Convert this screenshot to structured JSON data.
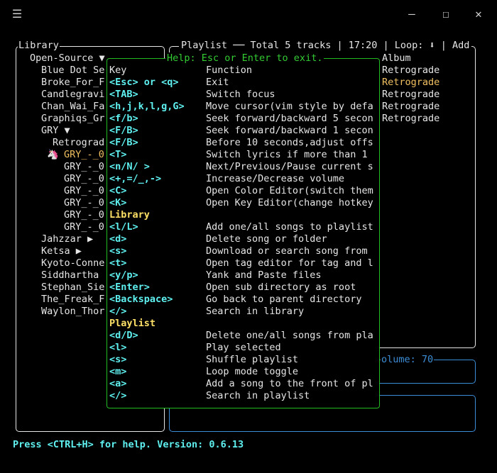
{
  "titlebar": {
    "menu_icon": "☰",
    "minimize": "—",
    "maximize": "☐",
    "close": "✕"
  },
  "library": {
    "title": "Library",
    "items": [
      {
        "text": "Open-Source ▼",
        "indent": 1
      },
      {
        "text": "Blue Dot Se",
        "indent": 2
      },
      {
        "text": "Broke_For_F",
        "indent": 2
      },
      {
        "text": "Candlegravi",
        "indent": 2
      },
      {
        "text": "Chan_Wai_Fa",
        "indent": 2
      },
      {
        "text": "Graphiqs_Gr",
        "indent": 2
      },
      {
        "text": "GRY ▼",
        "indent": 2
      },
      {
        "text": "Retrograd",
        "indent": 3
      },
      {
        "text": "GRY_-_0",
        "indent": 4,
        "selected": true
      },
      {
        "text": "GRY_-_0",
        "indent": 4
      },
      {
        "text": "GRY_-_0",
        "indent": 4
      },
      {
        "text": "GRY_-_0",
        "indent": 4
      },
      {
        "text": "GRY_-_0",
        "indent": 4
      },
      {
        "text": "GRY_-_0",
        "indent": 4
      },
      {
        "text": "GRY_-_0",
        "indent": 4
      },
      {
        "text": "Jahzzar ▶",
        "indent": 2
      },
      {
        "text": "Ketsa ▶",
        "indent": 2
      },
      {
        "text": "Kyoto-Conne",
        "indent": 2
      },
      {
        "text": "Siddhartha",
        "indent": 2
      },
      {
        "text": "Stephan_Sie",
        "indent": 2
      },
      {
        "text": "The_Freak_F",
        "indent": 2
      },
      {
        "text": "Waylon_Thor",
        "indent": 2
      }
    ],
    "selected_icon": "🦄"
  },
  "playlist": {
    "header": "Playlist ── Total 5 tracks | 17:20 | Loop: ⬇ | Add",
    "album_header": "Album",
    "albums": [
      "Retrograde",
      "Retrograde",
      "Retrograde",
      "Retrograde",
      "Retrograde"
    ],
    "playing_index": 1
  },
  "volume": {
    "label": "olume: 70"
  },
  "help": {
    "title": "Help: Esc or Enter to exit.",
    "header_key": "Key",
    "header_function": "Function",
    "rows": [
      {
        "key": "<Esc> or <q>",
        "func": "Exit"
      },
      {
        "key": "<TAB>",
        "func": "Switch focus"
      },
      {
        "key": "<h,j,k,l,g,G>",
        "func": "Move cursor(vim style by defa"
      },
      {
        "key": "<f/b>",
        "func": "Seek forward/backward 5 secon"
      },
      {
        "key": "<F/B>",
        "func": "Seek forward/backward 1 secon"
      },
      {
        "key": "<F/B>",
        "func": "Before 10 seconds,adjust offs"
      },
      {
        "key": "<T>",
        "func": "Switch lyrics if more than 1"
      },
      {
        "key": "<n/N/ >",
        "func": "Next/Previous/Pause current s"
      },
      {
        "key": "<+,=/_,->",
        "func": "Increase/Decrease volume"
      },
      {
        "key": "<C>",
        "func": "Open Color Editor(switch them"
      },
      {
        "key": "<K>",
        "func": "Open Key Editor(change hotkey"
      },
      {
        "section": "Library"
      },
      {
        "key": "<l/L>",
        "func": "Add one/all songs to playlist"
      },
      {
        "key": "<d>",
        "func": "Delete song or folder"
      },
      {
        "key": "<s>",
        "func": "Download or search song from"
      },
      {
        "key": "<t>",
        "func": "Open tag editor for tag and l"
      },
      {
        "key": "<y/p>",
        "func": "Yank and Paste files"
      },
      {
        "key": "<Enter>",
        "func": "Open sub directory as root"
      },
      {
        "key": "<Backspace>",
        "func": "Go back to parent directory"
      },
      {
        "key": "</>",
        "func": "Search in library"
      },
      {
        "section": "Playlist"
      },
      {
        "key": "<d/D>",
        "func": "Delete one/all songs from pla"
      },
      {
        "key": "<l>",
        "func": "Play selected"
      },
      {
        "key": "<s>",
        "func": "Shuffle playlist"
      },
      {
        "key": "<m>",
        "func": "Loop mode toggle"
      },
      {
        "key": "<a>",
        "func": "Add a song to the front of pl"
      },
      {
        "key": "</>",
        "func": "Search in playlist"
      }
    ]
  },
  "footer": {
    "text": "Press <CTRL+H> for help. Version: 0.6.13"
  },
  "colors": {
    "cyan": "#5ff0f0",
    "yellow": "#ffe066",
    "green": "#33cc33",
    "blue": "#3b8ed6",
    "gold": "#f0c060"
  }
}
